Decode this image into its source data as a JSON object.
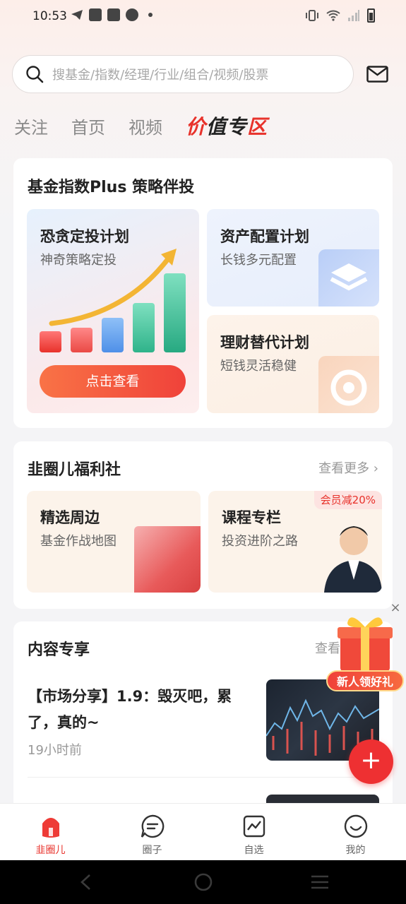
{
  "status_bar": {
    "time": "10:53"
  },
  "search": {
    "placeholder": "搜基金/指数/经理/行业/组合/视频/股票"
  },
  "tabs": [
    {
      "label": "关注"
    },
    {
      "label": "首页"
    },
    {
      "label": "视频"
    }
  ],
  "special_tab": {
    "part1": "价",
    "part2": "值专",
    "part3": "区"
  },
  "strategy": {
    "title": "基金指数Plus 策略伴投",
    "fear_greed": {
      "title": "恐贪定投计划",
      "subtitle": "神奇策略定投",
      "cta": "点击查看"
    },
    "asset_alloc": {
      "title": "资产配置计划",
      "subtitle": "长钱多元配置"
    },
    "wealth_alt": {
      "title": "理财替代计划",
      "subtitle": "短钱灵活稳健"
    }
  },
  "welfare": {
    "title": "韭圈儿福利社",
    "more": "查看更多 ›",
    "merch": {
      "title": "精选周边",
      "subtitle": "基金作战地图"
    },
    "course": {
      "title": "课程专栏",
      "subtitle": "投资进阶之路",
      "badge": "会员减20%"
    }
  },
  "content": {
    "title": "内容专享",
    "more": "查看",
    "article": {
      "title": "【市场分享】1.9：毁灭吧，累了，真的~",
      "time": "19小时前"
    }
  },
  "gift": {
    "label": "新人领好礼"
  },
  "bottom_nav": [
    {
      "label": "韭圈儿"
    },
    {
      "label": "圈子"
    },
    {
      "label": "自选"
    },
    {
      "label": "我的"
    }
  ],
  "colors": {
    "accent": "#e8322b",
    "cta_start": "#f97346",
    "cta_end": "#f0423a"
  }
}
